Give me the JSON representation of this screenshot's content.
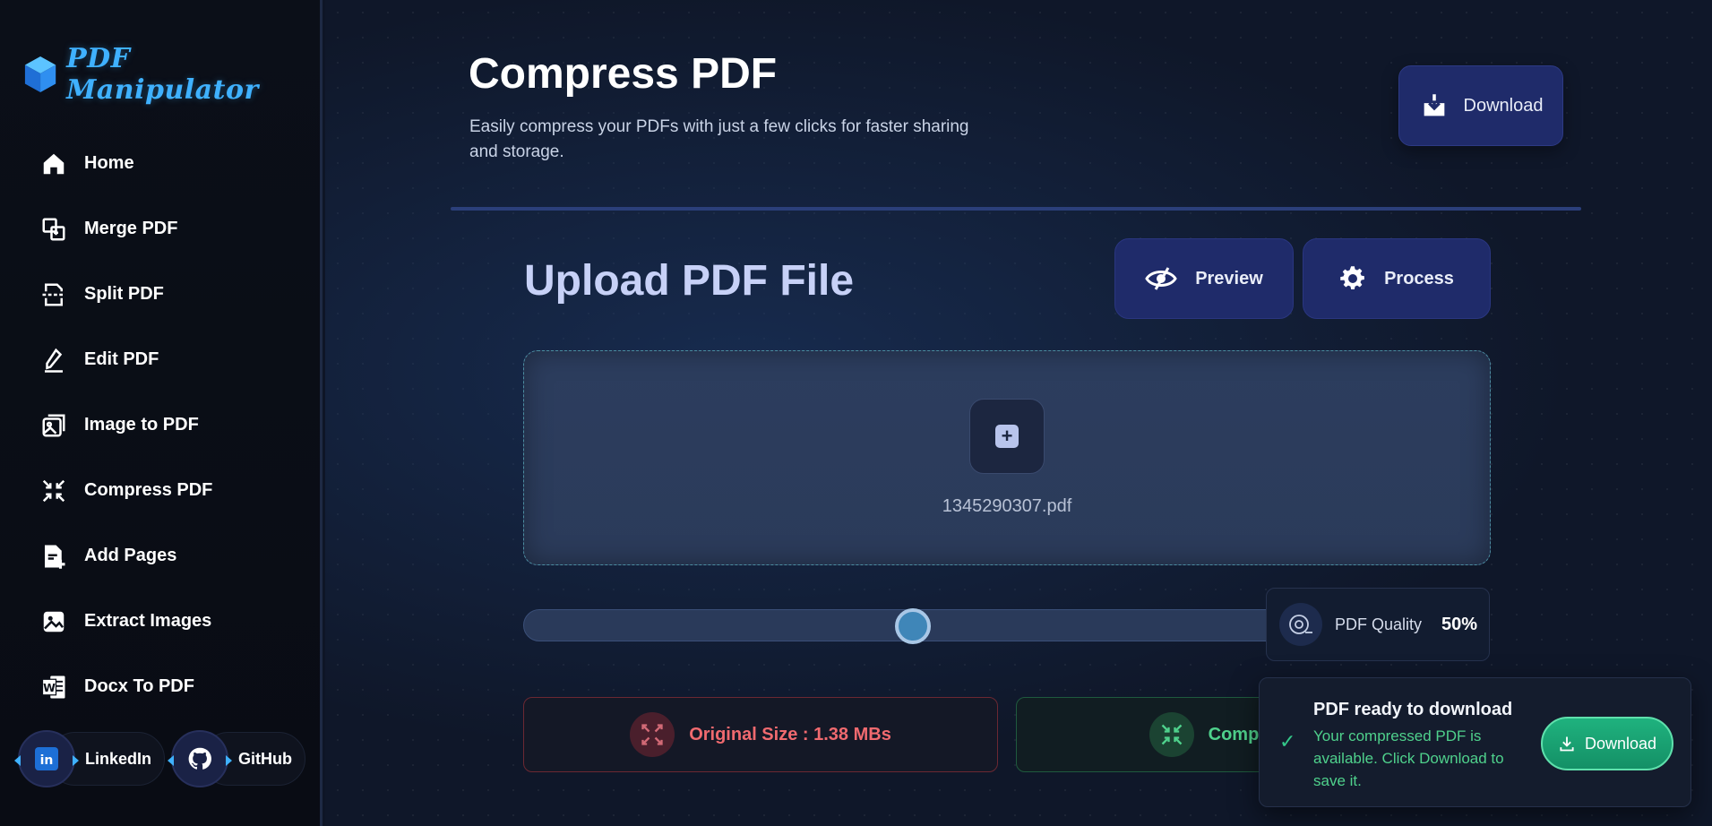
{
  "app": {
    "name": "PDF Manipulator"
  },
  "sidebar": {
    "items": [
      {
        "label": "Home",
        "icon": "home-icon"
      },
      {
        "label": "Merge PDF",
        "icon": "merge-icon"
      },
      {
        "label": "Split PDF",
        "icon": "split-icon"
      },
      {
        "label": "Edit PDF",
        "icon": "edit-icon"
      },
      {
        "label": "Image to PDF",
        "icon": "image-to-pdf-icon"
      },
      {
        "label": "Compress PDF",
        "icon": "compress-icon"
      },
      {
        "label": "Add Pages",
        "icon": "add-pages-icon"
      },
      {
        "label": "Extract Images",
        "icon": "extract-images-icon"
      },
      {
        "label": "Docx To PDF",
        "icon": "word-icon"
      }
    ],
    "social": {
      "linkedin": "LinkedIn",
      "github": "GitHub"
    }
  },
  "header": {
    "title": "Compress PDF",
    "subtitle": "Easily compress your PDFs with just a few clicks for faster sharing and storage.",
    "download_label": "Download"
  },
  "upload": {
    "title": "Upload PDF File",
    "preview_label": "Preview",
    "process_label": "Process",
    "filename": "1345290307.pdf"
  },
  "quality": {
    "label": "PDF Quality",
    "value_text": "50%",
    "value": 50
  },
  "sizes": {
    "original": "Original Size : 1.38 MBs",
    "compressed": "Compressed Size"
  },
  "toast": {
    "title": "PDF ready to download",
    "message": "Your compressed PDF is available. Click Download to save it.",
    "button_label": "Download"
  },
  "colors": {
    "accent": "#3fb1ff",
    "primary_button": "#1f2b6a",
    "success": "#1fb27e",
    "danger": "#f06a6f"
  }
}
